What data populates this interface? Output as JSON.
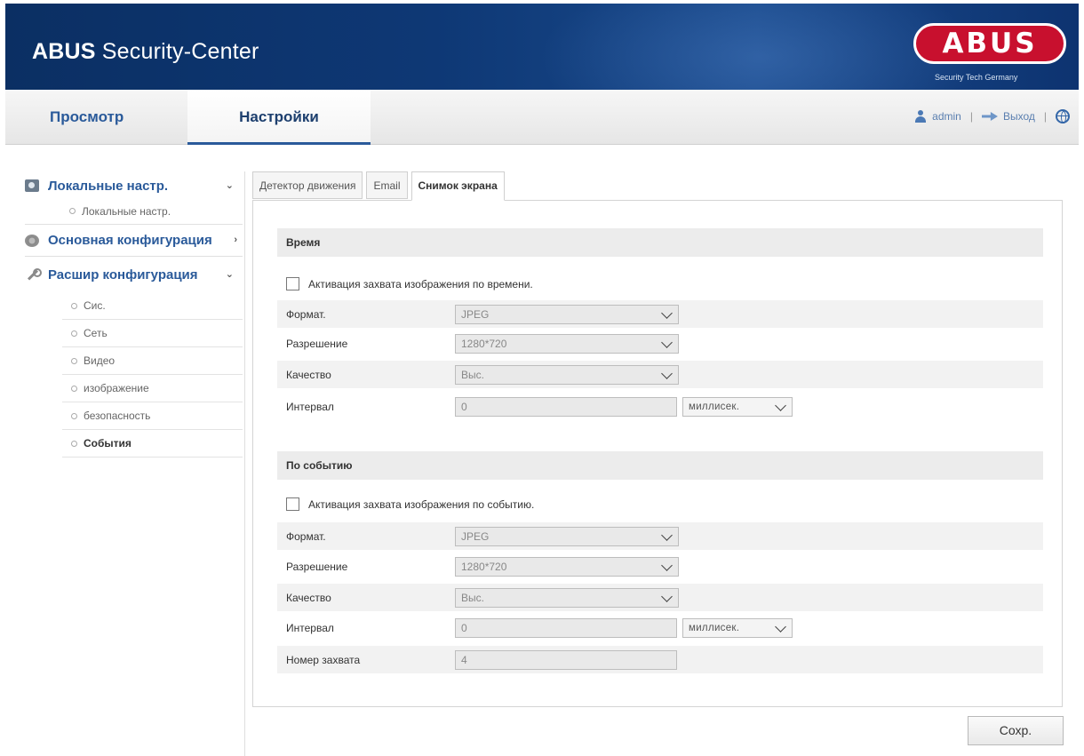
{
  "header": {
    "brand": "ABUS",
    "title_rest": "Security-Center",
    "logo_text": "ABUS",
    "logo_sub": "Security Tech Germany"
  },
  "nav": {
    "tabs": [
      {
        "label": "Просмотр"
      },
      {
        "label": "Настройки",
        "active": true
      }
    ],
    "user": "admin",
    "logout": "Выход",
    "separator": "|"
  },
  "sidebar": {
    "local": {
      "label": "Локальные настр.",
      "chevron": "⌄",
      "children": [
        "Локальные настр."
      ]
    },
    "basic": {
      "label": "Основная конфигурация",
      "chevron": "›"
    },
    "advanced": {
      "label": "Расшир конфигурация",
      "chevron": "⌄",
      "children": [
        "Сис.",
        "Сеть",
        "Видео",
        "изображение",
        "безопасность",
        "События"
      ],
      "active": "События"
    }
  },
  "subtabs": [
    "Детектор движения",
    "Email",
    "Снимок экрана"
  ],
  "active_subtab": "Снимок экрана",
  "time_section": {
    "title": "Время",
    "checkbox_label": "Активация захвата изображения по времени.",
    "format": {
      "label": "Формат.",
      "value": "JPEG"
    },
    "resolution": {
      "label": "Разрешение",
      "value": "1280*720"
    },
    "quality": {
      "label": "Качество",
      "value": "Выс."
    },
    "interval": {
      "label": "Интервал",
      "value": "0",
      "unit": "миллисек."
    }
  },
  "event_section": {
    "title": "По событию",
    "checkbox_label": "Активация захвата изображения по событию.",
    "format": {
      "label": "Формат.",
      "value": "JPEG"
    },
    "resolution": {
      "label": "Разрешение",
      "value": "1280*720"
    },
    "quality": {
      "label": "Качество",
      "value": "Выс."
    },
    "interval": {
      "label": "Интервал",
      "value": "0",
      "unit": "миллисек."
    },
    "capture_number": {
      "label": "Номер захвата",
      "value": "4"
    }
  },
  "save_label": "Сохр."
}
